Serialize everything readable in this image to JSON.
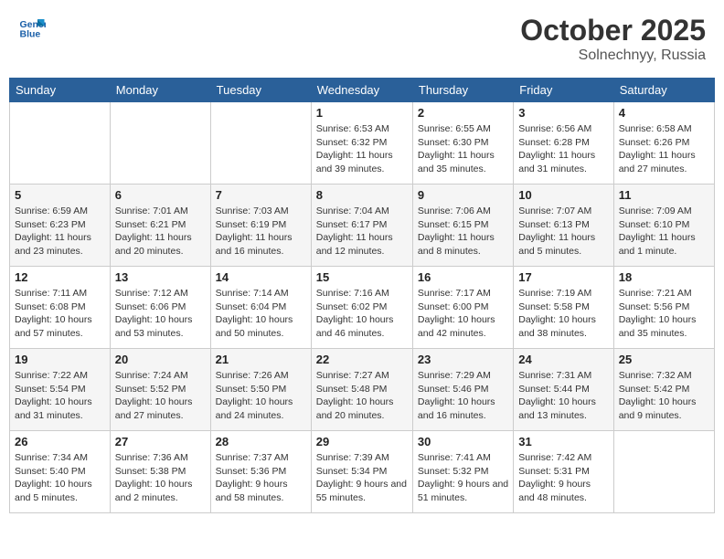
{
  "header": {
    "logo_line1": "General",
    "logo_line2": "Blue",
    "month": "October 2025",
    "location": "Solnechnyy, Russia"
  },
  "days_of_week": [
    "Sunday",
    "Monday",
    "Tuesday",
    "Wednesday",
    "Thursday",
    "Friday",
    "Saturday"
  ],
  "weeks": [
    [
      {
        "day": "",
        "info": ""
      },
      {
        "day": "",
        "info": ""
      },
      {
        "day": "",
        "info": ""
      },
      {
        "day": "1",
        "info": "Sunrise: 6:53 AM\nSunset: 6:32 PM\nDaylight: 11 hours and 39 minutes."
      },
      {
        "day": "2",
        "info": "Sunrise: 6:55 AM\nSunset: 6:30 PM\nDaylight: 11 hours and 35 minutes."
      },
      {
        "day": "3",
        "info": "Sunrise: 6:56 AM\nSunset: 6:28 PM\nDaylight: 11 hours and 31 minutes."
      },
      {
        "day": "4",
        "info": "Sunrise: 6:58 AM\nSunset: 6:26 PM\nDaylight: 11 hours and 27 minutes."
      }
    ],
    [
      {
        "day": "5",
        "info": "Sunrise: 6:59 AM\nSunset: 6:23 PM\nDaylight: 11 hours and 23 minutes."
      },
      {
        "day": "6",
        "info": "Sunrise: 7:01 AM\nSunset: 6:21 PM\nDaylight: 11 hours and 20 minutes."
      },
      {
        "day": "7",
        "info": "Sunrise: 7:03 AM\nSunset: 6:19 PM\nDaylight: 11 hours and 16 minutes."
      },
      {
        "day": "8",
        "info": "Sunrise: 7:04 AM\nSunset: 6:17 PM\nDaylight: 11 hours and 12 minutes."
      },
      {
        "day": "9",
        "info": "Sunrise: 7:06 AM\nSunset: 6:15 PM\nDaylight: 11 hours and 8 minutes."
      },
      {
        "day": "10",
        "info": "Sunrise: 7:07 AM\nSunset: 6:13 PM\nDaylight: 11 hours and 5 minutes."
      },
      {
        "day": "11",
        "info": "Sunrise: 7:09 AM\nSunset: 6:10 PM\nDaylight: 11 hours and 1 minute."
      }
    ],
    [
      {
        "day": "12",
        "info": "Sunrise: 7:11 AM\nSunset: 6:08 PM\nDaylight: 10 hours and 57 minutes."
      },
      {
        "day": "13",
        "info": "Sunrise: 7:12 AM\nSunset: 6:06 PM\nDaylight: 10 hours and 53 minutes."
      },
      {
        "day": "14",
        "info": "Sunrise: 7:14 AM\nSunset: 6:04 PM\nDaylight: 10 hours and 50 minutes."
      },
      {
        "day": "15",
        "info": "Sunrise: 7:16 AM\nSunset: 6:02 PM\nDaylight: 10 hours and 46 minutes."
      },
      {
        "day": "16",
        "info": "Sunrise: 7:17 AM\nSunset: 6:00 PM\nDaylight: 10 hours and 42 minutes."
      },
      {
        "day": "17",
        "info": "Sunrise: 7:19 AM\nSunset: 5:58 PM\nDaylight: 10 hours and 38 minutes."
      },
      {
        "day": "18",
        "info": "Sunrise: 7:21 AM\nSunset: 5:56 PM\nDaylight: 10 hours and 35 minutes."
      }
    ],
    [
      {
        "day": "19",
        "info": "Sunrise: 7:22 AM\nSunset: 5:54 PM\nDaylight: 10 hours and 31 minutes."
      },
      {
        "day": "20",
        "info": "Sunrise: 7:24 AM\nSunset: 5:52 PM\nDaylight: 10 hours and 27 minutes."
      },
      {
        "day": "21",
        "info": "Sunrise: 7:26 AM\nSunset: 5:50 PM\nDaylight: 10 hours and 24 minutes."
      },
      {
        "day": "22",
        "info": "Sunrise: 7:27 AM\nSunset: 5:48 PM\nDaylight: 10 hours and 20 minutes."
      },
      {
        "day": "23",
        "info": "Sunrise: 7:29 AM\nSunset: 5:46 PM\nDaylight: 10 hours and 16 minutes."
      },
      {
        "day": "24",
        "info": "Sunrise: 7:31 AM\nSunset: 5:44 PM\nDaylight: 10 hours and 13 minutes."
      },
      {
        "day": "25",
        "info": "Sunrise: 7:32 AM\nSunset: 5:42 PM\nDaylight: 10 hours and 9 minutes."
      }
    ],
    [
      {
        "day": "26",
        "info": "Sunrise: 7:34 AM\nSunset: 5:40 PM\nDaylight: 10 hours and 5 minutes."
      },
      {
        "day": "27",
        "info": "Sunrise: 7:36 AM\nSunset: 5:38 PM\nDaylight: 10 hours and 2 minutes."
      },
      {
        "day": "28",
        "info": "Sunrise: 7:37 AM\nSunset: 5:36 PM\nDaylight: 9 hours and 58 minutes."
      },
      {
        "day": "29",
        "info": "Sunrise: 7:39 AM\nSunset: 5:34 PM\nDaylight: 9 hours and 55 minutes."
      },
      {
        "day": "30",
        "info": "Sunrise: 7:41 AM\nSunset: 5:32 PM\nDaylight: 9 hours and 51 minutes."
      },
      {
        "day": "31",
        "info": "Sunrise: 7:42 AM\nSunset: 5:31 PM\nDaylight: 9 hours and 48 minutes."
      },
      {
        "day": "",
        "info": ""
      }
    ]
  ]
}
